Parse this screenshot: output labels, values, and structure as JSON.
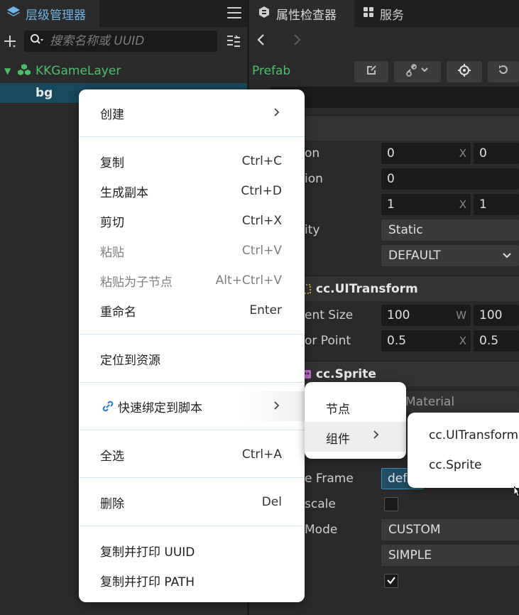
{
  "hierarchy": {
    "tab_title": "层级管理器",
    "search_placeholder": "搜索名称或 UUID",
    "tree": {
      "root_label": "KKGameLayer",
      "child_label": "bg"
    }
  },
  "inspector": {
    "tabs": [
      {
        "label": "属性检查器"
      },
      {
        "label": "服务"
      }
    ],
    "prefab_label": "Prefab",
    "node_props": [
      {
        "label": "on",
        "x": "0",
        "y": "0"
      },
      {
        "label": "ion",
        "value": "0"
      },
      {
        "label": "",
        "x": "1",
        "y": "1"
      },
      {
        "label": "ity",
        "value": "Static"
      },
      {
        "label": "",
        "value": "DEFAULT"
      }
    ],
    "uitransform": {
      "title": "cc.UITransform",
      "content_size_label": "ent Size",
      "width": "100",
      "height": "100",
      "anchor_label": "or Point",
      "anchor_x": "0.5",
      "anchor_y": "0.5"
    },
    "sprite": {
      "title": "cc.Sprite",
      "material": "Material",
      "frame_label": "e Frame",
      "frame_value": "defa",
      "grayscale_label": "scale",
      "sizemode_label": "Mode",
      "sizemode_value": "CUSTOM",
      "type_value": "SIMPLE"
    },
    "axis_labels": {
      "x": "X",
      "w": "W"
    }
  },
  "context_menu": {
    "items": [
      {
        "label": "创建",
        "has_submenu": true
      },
      {
        "label": "复制",
        "shortcut": "Ctrl+C"
      },
      {
        "label": "生成副本",
        "shortcut": "Ctrl+D"
      },
      {
        "label": "剪切",
        "shortcut": "Ctrl+X"
      },
      {
        "label": "粘贴",
        "shortcut": "Ctrl+V",
        "disabled": true
      },
      {
        "label": "粘贴为子节点",
        "shortcut": "Alt+Ctrl+V",
        "disabled": true
      },
      {
        "label": "重命名",
        "shortcut": "Enter"
      },
      {
        "label": "定位到资源"
      },
      {
        "label": "快速绑定到脚本",
        "has_submenu": true
      },
      {
        "label": "全选",
        "shortcut": "Ctrl+A"
      },
      {
        "label": "删除",
        "shortcut": "Del"
      },
      {
        "label": "复制并打印 UUID"
      },
      {
        "label": "复制并打印 PATH"
      }
    ],
    "submenu_bind": {
      "items": [
        {
          "label": "节点"
        },
        {
          "label": "组件",
          "has_submenu": true
        }
      ]
    },
    "submenu_components": {
      "items": [
        {
          "label": "cc.UITransform"
        },
        {
          "label": "cc.Sprite"
        }
      ]
    }
  },
  "colors": {
    "accent_blue": "#6fb4e8",
    "node_green": "#4cbf6a",
    "selection_bg": "#174a5e",
    "panel_bg": "#2b2b2b"
  }
}
